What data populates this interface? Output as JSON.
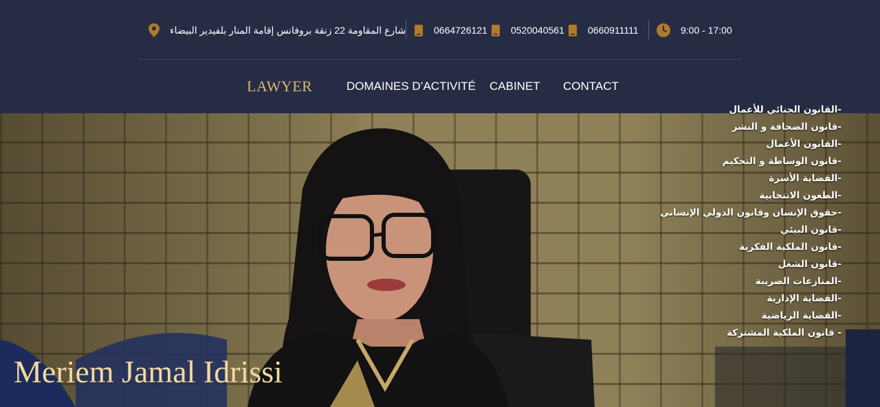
{
  "topbar": {
    "address": "شارع المقاومة 22 زنقة بروفانس إقامة المنار بلفيدير البيضاء",
    "phones": [
      "0664726121",
      "0520040561",
      "0660911111"
    ],
    "hours": "9:00 - 17:00",
    "icons": {
      "address": "map-pin-icon",
      "phone": "phone-icon",
      "hours": "clock-icon"
    },
    "icon_color": "#b07a2a"
  },
  "nav": {
    "logo": "LAWYER",
    "links": [
      "DOMAINES D’ACTIVITÉ",
      "CABINET",
      "CONTACT"
    ]
  },
  "dropdown": {
    "items": [
      "-القانون الجنائي للأعمال",
      "-قانون الصحافة و النشر",
      "-القانون الأعمال",
      "-قانون الوساطة و التحكيم",
      "-القضاية الأسرة",
      "-الطعون الانتخابية",
      "-حقوق الإنسان وقانون الدولي الإنساني",
      "-قانون البيئي",
      "-قانون الملكية الفكرية",
      "-قانون الشغل",
      "-المنازعات الضريبة",
      "-القضاية الإدارية",
      "-القضاية الرياضية",
      "- قانون الملكية المشتركة"
    ]
  },
  "hero": {
    "name": "Meriem Jamal Idrissi"
  },
  "colors": {
    "header_bg": "#272c45",
    "accent_gold": "#d9b86a"
  }
}
